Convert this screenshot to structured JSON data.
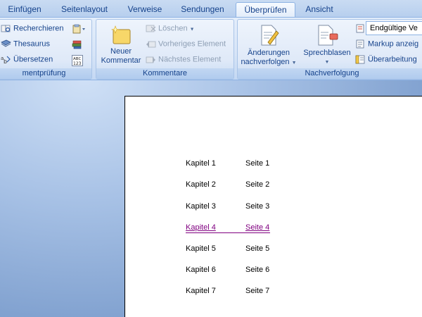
{
  "tabs": [
    {
      "label": "Einfügen",
      "active": false
    },
    {
      "label": "Seitenlayout",
      "active": false
    },
    {
      "label": "Verweise",
      "active": false
    },
    {
      "label": "Sendungen",
      "active": false
    },
    {
      "label": "Überprüfen",
      "active": true
    },
    {
      "label": "Ansicht",
      "active": false
    }
  ],
  "ribbon": {
    "proofing": {
      "label": "mentprüfung",
      "research": "Recherchieren",
      "thesaurus": "Thesaurus",
      "translate": "Übersetzen"
    },
    "comments": {
      "label": "Kommentare",
      "new_comment_line1": "Neuer",
      "new_comment_line2": "Kommentar",
      "delete": "Löschen",
      "previous": "Vorheriges Element",
      "next": "Nächstes Element"
    },
    "tracking": {
      "label": "Nachverfolgung",
      "track_changes_line1": "Änderungen",
      "track_changes_line2": "nachverfolgen",
      "balloons": "Sprechblasen",
      "display_value": "Endgültige Ve",
      "show_markup": "Markup anzeig",
      "reviewing_pane": "Überarbeitung"
    }
  },
  "document": {
    "toc": [
      {
        "chapter": "Kapitel  1",
        "page": "Seite 1",
        "link": false
      },
      {
        "chapter": "Kapitel 2",
        "page": "Seite 2",
        "link": false
      },
      {
        "chapter": "Kapitel 3",
        "page": "Seite 3",
        "link": false
      },
      {
        "chapter": "Kapitel 4",
        "page": "Seite 4",
        "link": true
      },
      {
        "chapter": "Kapitel 5",
        "page": "Seite 5",
        "link": false
      },
      {
        "chapter": "Kapitel 6",
        "page": "Seite 6",
        "link": false
      },
      {
        "chapter": "Kapitel 7",
        "page": "Seite 7",
        "link": false
      }
    ]
  },
  "colors": {
    "ribbon_text": "#15428b",
    "link_visited": "#800080",
    "workspace": "#7b9ccb"
  }
}
